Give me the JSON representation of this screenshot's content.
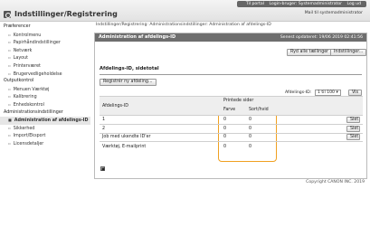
{
  "header": {
    "title": "Indstillinger/Registrering",
    "top_links": [
      "Til portal",
      "Login-bruger: Systemadministrator",
      "Log ud"
    ],
    "sub_link": "Mail til systemadministrator"
  },
  "sidebar": {
    "groups": [
      {
        "label": "Præferencer",
        "items": [
          {
            "label": "Kontrolmenu"
          },
          {
            "label": "Papirhåndindstillinger"
          },
          {
            "label": "Netværk"
          },
          {
            "label": "Layout"
          },
          {
            "label": "Printerværet"
          },
          {
            "label": "Brugervedligeholdelse"
          }
        ]
      },
      {
        "label": "Outputkontrol",
        "items": [
          {
            "label": "Menuen Værktøj"
          },
          {
            "label": "Kalibrering"
          },
          {
            "label": "Enhedskontrol"
          }
        ]
      },
      {
        "label": "Administrationsindstillinger",
        "items": [
          {
            "label": "Administration af afdelings-ID",
            "active": true
          },
          {
            "label": "Sikkerhed"
          },
          {
            "label": "Import/Eksport"
          },
          {
            "label": "Licensdetaljer"
          }
        ]
      }
    ]
  },
  "breadcrumb": "Indstillinger/Registrering: Administrationsindstillinger: Administration af afdelings-ID",
  "panel": {
    "title": "Administration af afdelings-ID",
    "last_update": "Senest opdateret: 19/06 2019 02:41:56",
    "btn_reset": "Ryd alle tællinger",
    "btn_settings": "Indstillinger..."
  },
  "section": {
    "title": "Afdelings-ID, sidetotal",
    "btn_register": "Registrér ny afdeling...",
    "page_select_label": "Afdelings-ID:",
    "page_select_value": "1 til 100",
    "go_button": "Vis"
  },
  "table": {
    "col_id": "Afdelings-ID",
    "group_header": "Printede sider",
    "col_color": "Farve",
    "col_bw": "Sort/hvid",
    "rows": [
      {
        "id": "1",
        "color": "0",
        "bw": "0",
        "action": "Slet"
      },
      {
        "id": "2",
        "color": "0",
        "bw": "0",
        "action": "Slet"
      },
      {
        "id": "Job med ukendte ID'er",
        "color": "0",
        "bw": "0",
        "action": "Slet"
      },
      {
        "id": "Værktøj, E-mailprint",
        "color": "0",
        "bw": "0",
        "action": ""
      }
    ]
  },
  "footer": "Copyright CANON INC. 2019"
}
